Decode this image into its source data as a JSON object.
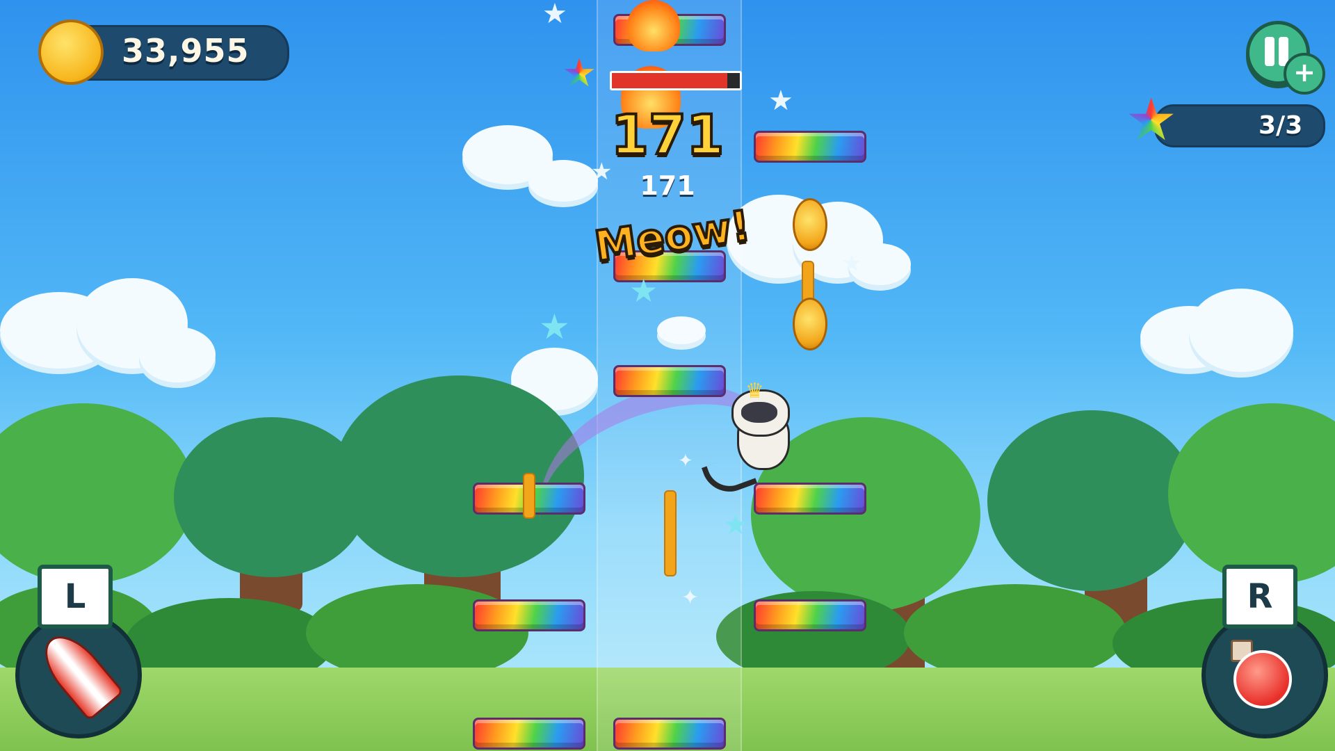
{
  "hud": {
    "coin_count": "33,955",
    "coin_icon": "paw-coin-icon",
    "stars_progress": "3/3",
    "star_icon": "rainbow-star-icon",
    "pause_icon": "pause-icon",
    "add_icon": "plus-icon"
  },
  "level": {
    "big_counter": "171",
    "small_counter": "171",
    "exclamation": "Meow!",
    "progress_fraction": 0.9
  },
  "powerups": {
    "left": {
      "key": "L",
      "icon": "rocket-icon"
    },
    "right": {
      "key": "R",
      "icon": "potion-icon"
    }
  },
  "colors": {
    "hud_bg": "#1e4a6e",
    "button_green": "#3fb98a",
    "progress_red": "#e2352a",
    "text_gold": "#ffd23a"
  }
}
